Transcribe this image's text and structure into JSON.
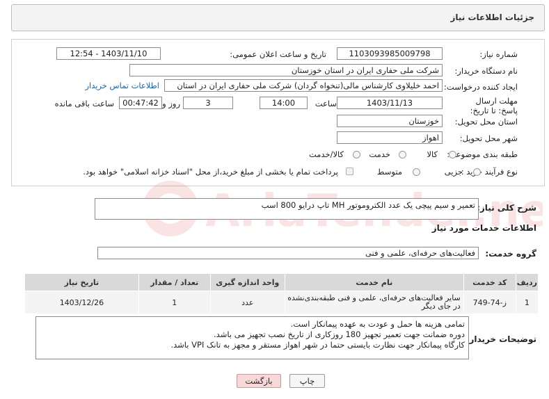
{
  "header": {
    "title": "جزئیات اطلاعات نیاز"
  },
  "form": {
    "need_number_label": "شماره نیاز:",
    "need_number": "1103093985009798",
    "announce_label": "تاریخ و ساعت اعلان عمومی:",
    "announce_value": "1403/11/10 - 12:54",
    "buyer_org_label": "نام دستگاه خریدار:",
    "buyer_org": "شرکت ملی حفاری ایران در استان خوزستان",
    "creator_label": "ایجاد کننده درخواست:",
    "creator": "احمد خلیلاوی کارشناس مالی(تنخواه گردان) شرکت ملی حفاری ایران در استان",
    "contact_link": "اطلاعات تماس خریدار",
    "deadline_label": "مهلت ارسال پاسخ: تا تاریخ:",
    "deadline_date": "1403/11/13",
    "time_word": "ساعت",
    "deadline_time": "14:00",
    "days": "3",
    "days_word": "روز و",
    "remaining": "00:47:42",
    "remaining_word": "ساعت باقی مانده",
    "province_label": "استان محل تحویل:",
    "province": "خوزستان",
    "city_label": "شهر محل تحویل:",
    "city": "اهواز",
    "category_label": "طبقه بندی موضوعی:",
    "category_options": [
      "کالا",
      "خدمت",
      "کالا/خدمت"
    ],
    "process_label": "نوع فرآیند خرید :",
    "process_options": [
      "جزیی",
      "متوسط"
    ],
    "payment_note": "پرداخت تمام یا بخشی از مبلغ خرید،از محل \"اسناد خزانه اسلامی\" خواهد بود."
  },
  "summary": {
    "label": "شرح کلی نیاز:",
    "value": "تعمیر و سیم پیچی یک عدد الکتروموتور MH تاپ درایو 800 اسب"
  },
  "services": {
    "section_title": "اطلاعات خدمات مورد نیاز",
    "group_label": "گروه خدمت:",
    "group_value": "فعالیت‌های حرفه‌ای، علمی و فنی",
    "columns": [
      "ردیف",
      "کد خدمت",
      "نام خدمت",
      "واحد اندازه گیری",
      "تعداد / مقدار",
      "تاریخ نیاز"
    ],
    "rows": [
      {
        "row": "1",
        "code": "ز-74-749",
        "name": "سایر فعالیت‌های حرفه‌ای، علمی و فنی طبقه‌بندی‌نشده در جای دیگر",
        "unit": "عدد",
        "qty": "1",
        "date": "1403/12/26"
      }
    ]
  },
  "buyer_notes": {
    "label": "توضیحات خریدار:",
    "lines": [
      "تمامی هزینه ها حمل و عودت به عهده پیمانکار است.",
      "دوره ضمانت جهت تعمیر تجهیز 180 روزکاری از تاریخ نصب تجهیز می باشد.",
      "کارگاه پیمانکار جهت نظارت بایستی حتما در شهر اهواز مستقر و مجهز به تانک VPI باشد."
    ]
  },
  "buttons": {
    "print": "چاپ",
    "back": "بازگشت"
  },
  "watermark": {
    "text": "AriaTender.neT"
  },
  "colors": {
    "link": "#1565c0",
    "back_button_bg": "#f8d7d7",
    "watermark": "#d32f2f"
  }
}
